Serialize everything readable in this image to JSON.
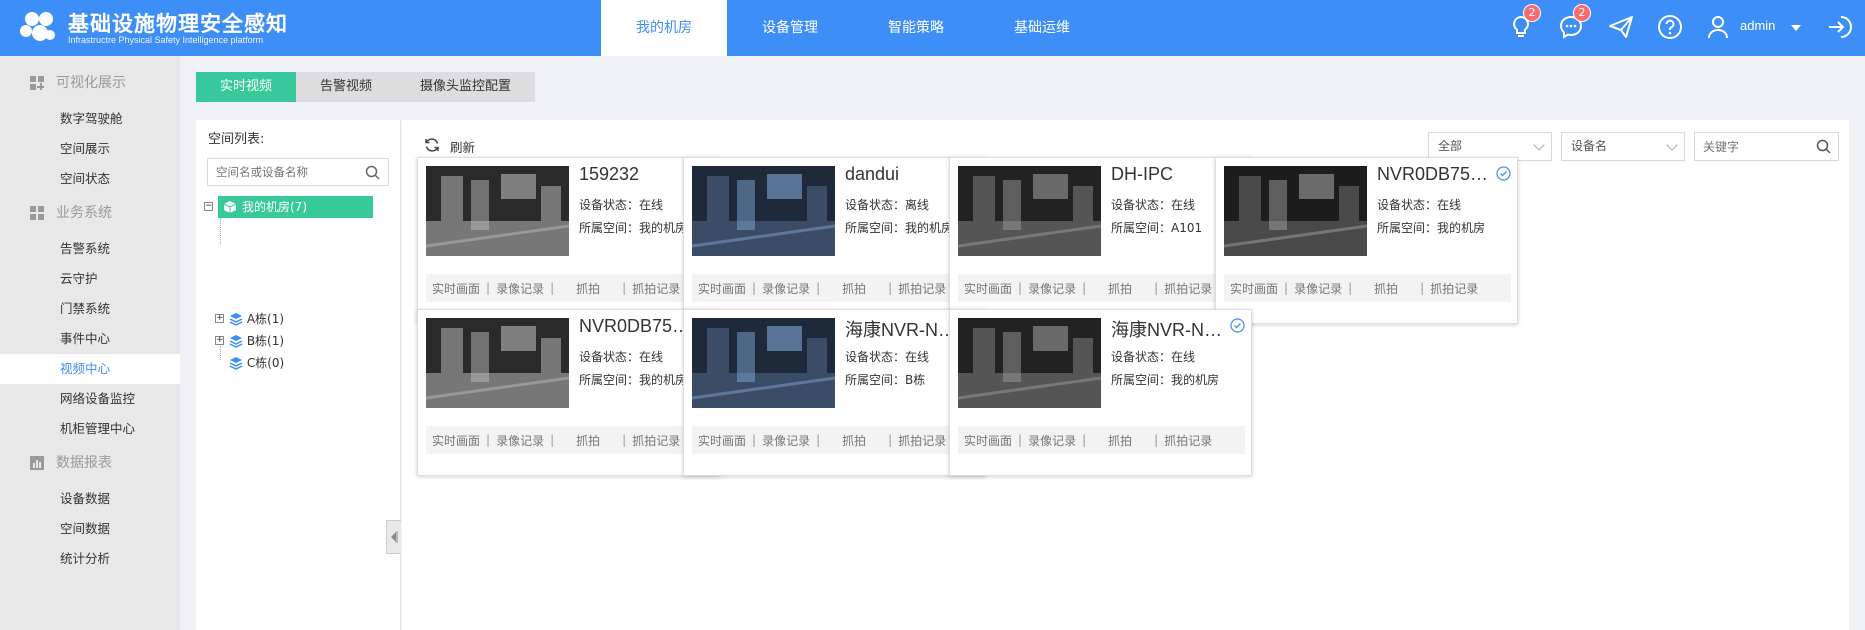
{
  "app": {
    "title": "基础设施物理安全感知",
    "subtitle": "Infrastructre Physical Safety Intelligence platform"
  },
  "nav": {
    "items": [
      {
        "label": "我的机房",
        "active": true
      },
      {
        "label": "设备管理",
        "active": false
      },
      {
        "label": "智能策略",
        "active": false
      },
      {
        "label": "基础运维",
        "active": false
      }
    ]
  },
  "topbar": {
    "notifications": {
      "icon": "lightbulb-icon",
      "count": "2"
    },
    "messages": {
      "icon": "chat-icon",
      "count": "2"
    },
    "send_icon": "send-icon",
    "help_icon": "help-icon",
    "user": {
      "name": "admin"
    },
    "logout_icon": "logout-icon"
  },
  "sidebar": {
    "groups": [
      {
        "label": "可视化展示",
        "icon": "dashboard-icon",
        "items": [
          "数字驾驶舱",
          "空间展示",
          "空间状态"
        ]
      },
      {
        "label": "业务系统",
        "icon": "business-icon",
        "items": [
          "告警系统",
          "云守护",
          "门禁系统",
          "事件中心",
          "视频中心",
          "网络设备监控",
          "机柜管理中心"
        ]
      },
      {
        "label": "数据报表",
        "icon": "report-icon",
        "items": [
          "设备数据",
          "空间数据",
          "统计分析"
        ]
      }
    ],
    "active_item": "视频中心"
  },
  "tabs": [
    {
      "label": "实时视频",
      "active": true
    },
    {
      "label": "告警视频",
      "active": false
    },
    {
      "label": "摄像头监控配置",
      "active": false
    }
  ],
  "tree": {
    "title": "空间列表:",
    "search_placeholder": "空间名或设备名称",
    "root": "我的机房(7)",
    "children": [
      "A栋(1)",
      "B栋(1)",
      "C栋(0)"
    ]
  },
  "toolbar": {
    "refresh_label": "刷新",
    "filter_scope": "全部",
    "filter_field": "设备名",
    "keyword_placeholder": "关键字"
  },
  "labels": {
    "status_prefix": "设备状态：",
    "space_prefix": "所属空间："
  },
  "card_actions": [
    "实时画面",
    "录像记录",
    "抓拍",
    "抓拍记录"
  ],
  "cameras": [
    {
      "name": "159232",
      "status": "在线",
      "space": "我的机房",
      "state": "online"
    },
    {
      "name": "dandui",
      "status": "离线",
      "space": "我的机房",
      "state": "offline"
    },
    {
      "name": "DH-IPC",
      "status": "在线",
      "space": "A101",
      "state": "online"
    },
    {
      "name": "NVR0DB750...",
      "status": "在线",
      "space": "我的机房",
      "state": "online"
    },
    {
      "name": "NVR0DB750...",
      "status": "在线",
      "space": "我的机房",
      "state": "online"
    },
    {
      "name": "海康NVR-NV...",
      "status": "在线",
      "space": "B栋",
      "state": "online"
    },
    {
      "name": "海康NVR-NV...",
      "status": "在线",
      "space": "我的机房",
      "state": "online"
    }
  ],
  "colors": {
    "brand": "#3e8ef7",
    "accent_green": "#38c99b",
    "online": "#3e8ef7",
    "offline": "#f56c6c"
  }
}
